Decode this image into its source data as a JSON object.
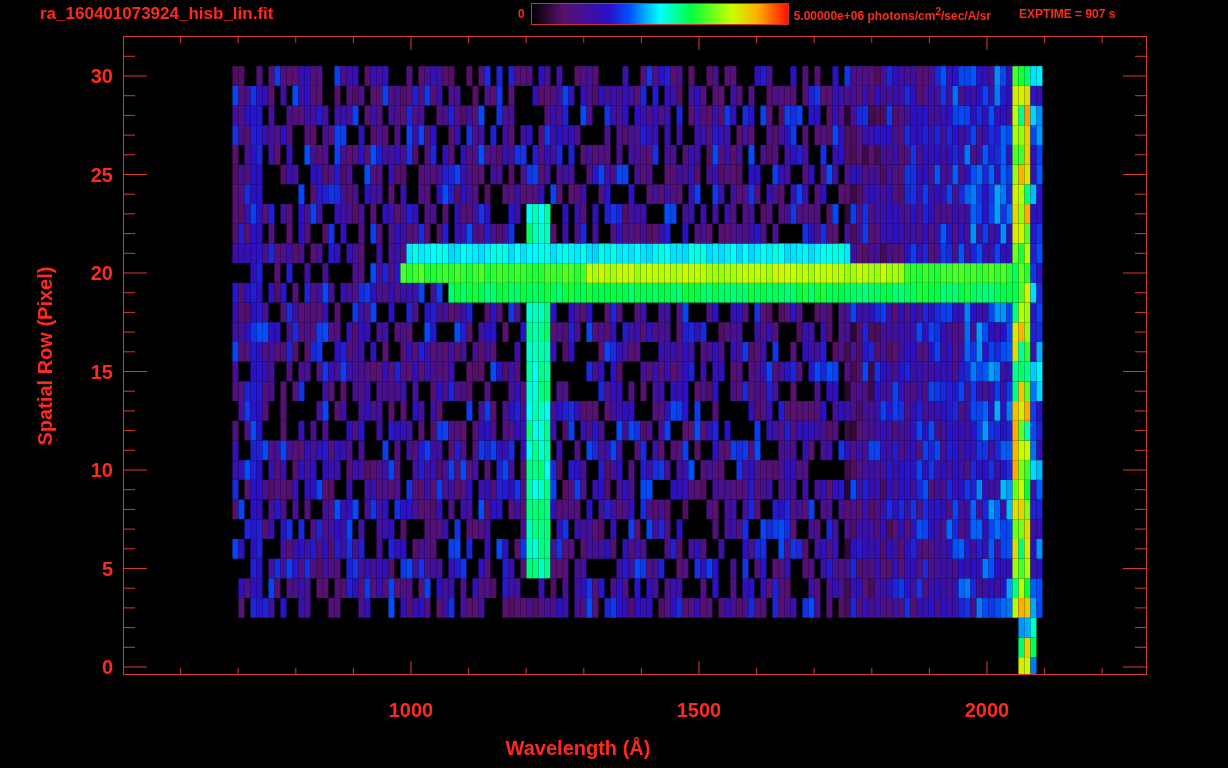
{
  "header": {
    "title": "ra_160401073924_hisb_lin.fit",
    "colorbar": {
      "min_label": "0",
      "max_label": "5.00000e+06 photons/cm$^{2}$/sec/A/sr"
    },
    "exposure": "EXPTIME = 907 s"
  },
  "plot": {
    "ylabel": "Spatial Row (Pixel)",
    "xlabel": "Wavelength (Å)",
    "yticks": [
      "30",
      "25",
      "20",
      "15",
      "10",
      "5",
      "0"
    ],
    "xticks": [
      "1000",
      "1500",
      "2000"
    ]
  }
}
